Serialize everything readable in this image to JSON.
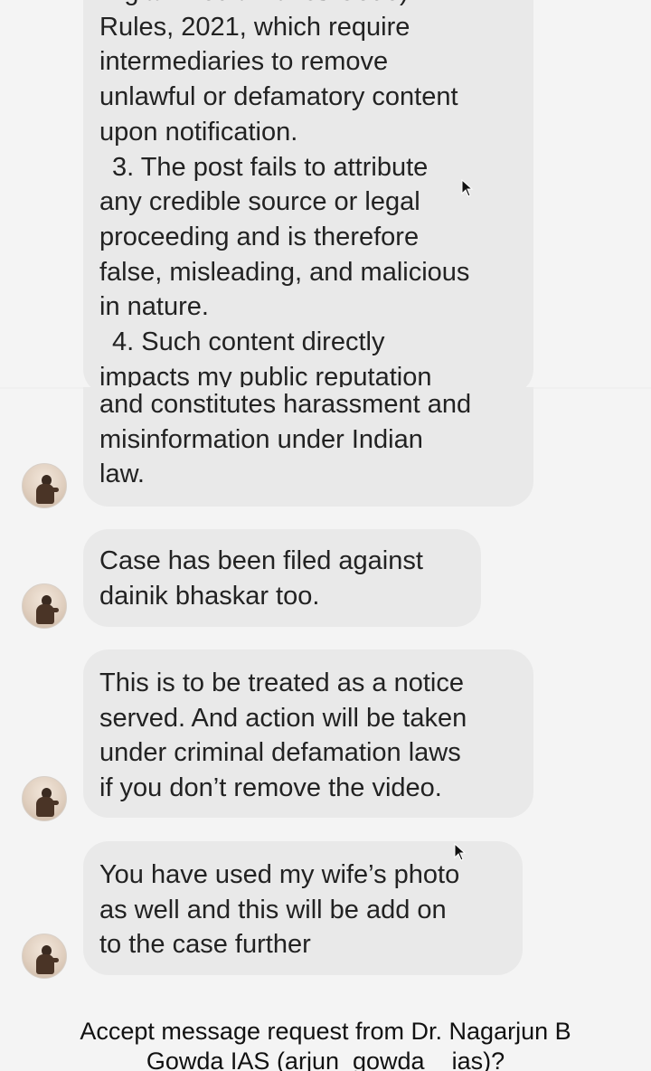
{
  "thread": {
    "messages": [
      {
        "lines": [
          "Digital Media Ethics Code)",
          "Rules, 2021, which require",
          "intermediaries to remove",
          "unlawful or defamatory content",
          "upon notification.",
          "3. The post fails to attribute",
          "any credible source or legal",
          "proceeding and is therefore",
          "false, misleading, and malicious",
          "in nature.",
          "4. Such content directly",
          "impacts my public reputation"
        ]
      },
      {
        "lines": [
          "and constitutes harassment and",
          "misinformation under Indian",
          "law."
        ]
      },
      {
        "lines": [
          "Case has been filed against",
          "dainik bhaskar too."
        ]
      },
      {
        "lines": [
          "This is to be treated as a notice",
          "served. And action will be taken",
          "under criminal defamation laws",
          "if you don’t remove the video."
        ]
      },
      {
        "lines": [
          "You have used my wife’s photo",
          "as well and this will be add on",
          "to the case further"
        ]
      }
    ]
  },
  "request_prompt": {
    "line1": "Accept message request from Dr. Nagarjun B",
    "line2": "Gowda IAS (arjun_gowda__ias)?"
  },
  "icons": {
    "avatar": "profile-avatar",
    "cursor": "mouse-pointer-icon"
  }
}
